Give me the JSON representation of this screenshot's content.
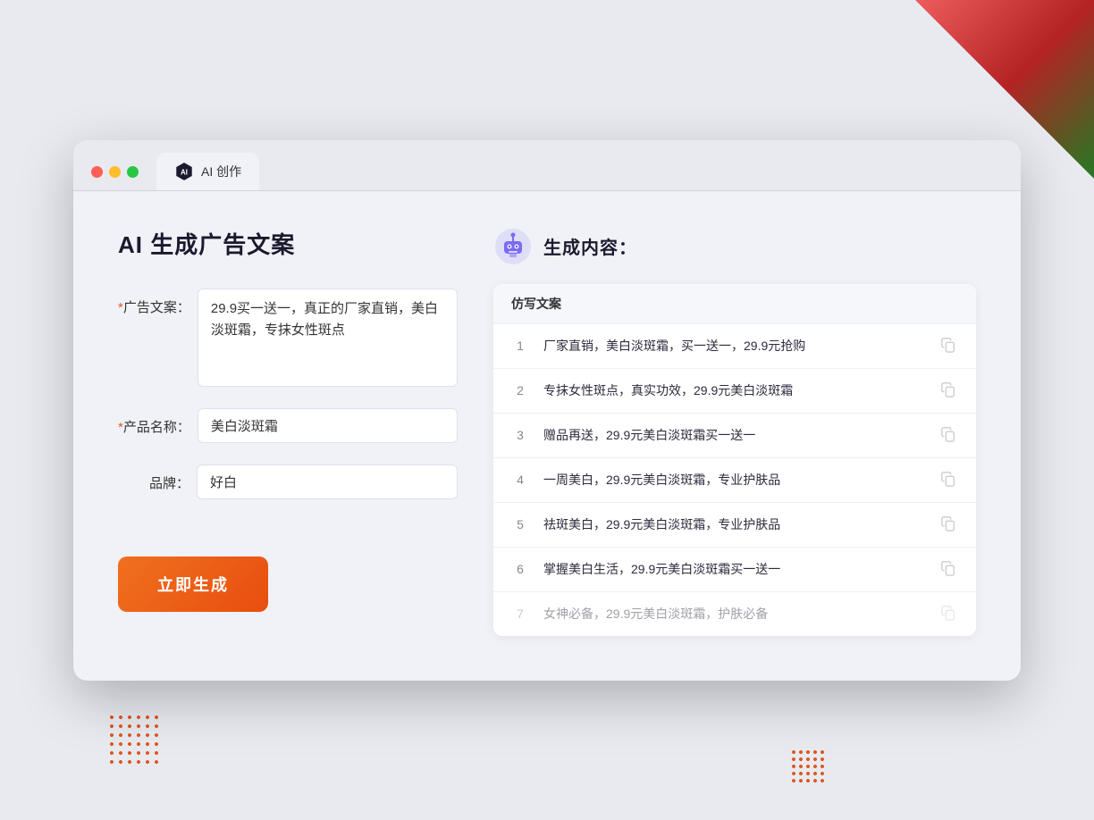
{
  "browser": {
    "tab_label": "AI 创作"
  },
  "page": {
    "title": "AI 生成广告文案",
    "result_title": "生成内容："
  },
  "form": {
    "ad_copy_label": "广告文案：",
    "ad_copy_required": "*",
    "ad_copy_value": "29.9买一送一，真正的厂家直销，美白淡斑霜，专抹女性斑点",
    "product_name_label": "产品名称：",
    "product_name_required": "*",
    "product_name_value": "美白淡斑霜",
    "brand_label": "品牌：",
    "brand_value": "好白",
    "generate_button": "立即生成"
  },
  "result": {
    "table_header": "仿写文案",
    "rows": [
      {
        "number": "1",
        "text": "厂家直销，美白淡斑霜，买一送一，29.9元抢购",
        "faded": false
      },
      {
        "number": "2",
        "text": "专抹女性斑点，真实功效，29.9元美白淡斑霜",
        "faded": false
      },
      {
        "number": "3",
        "text": "赠品再送，29.9元美白淡斑霜买一送一",
        "faded": false
      },
      {
        "number": "4",
        "text": "一周美白，29.9元美白淡斑霜，专业护肤品",
        "faded": false
      },
      {
        "number": "5",
        "text": "祛斑美白，29.9元美白淡斑霜，专业护肤品",
        "faded": false
      },
      {
        "number": "6",
        "text": "掌握美白生活，29.9元美白淡斑霜买一送一",
        "faded": false
      },
      {
        "number": "7",
        "text": "女神必备，29.9元美白淡斑霜，护肤必备",
        "faded": true
      }
    ]
  }
}
